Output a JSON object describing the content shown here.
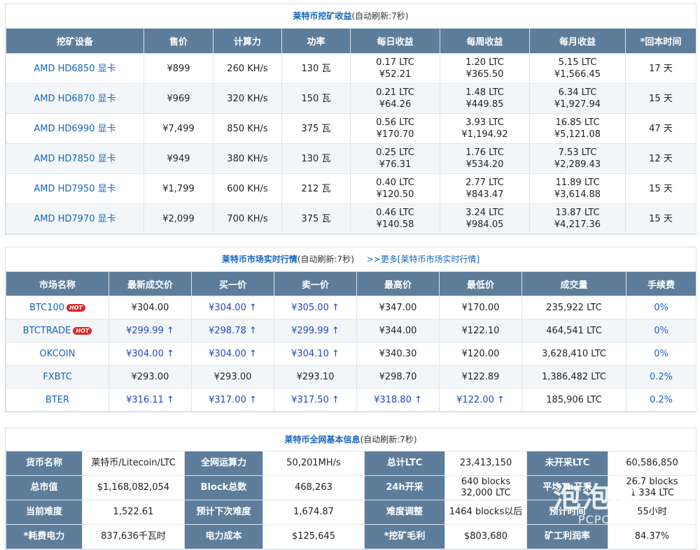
{
  "mining": {
    "title": "莱特币挖矿收益",
    "title_note": "(自动刷新:7秒)",
    "headers": [
      "挖矿设备",
      "售价",
      "计算力",
      "功率",
      "每日收益",
      "每周收益",
      "每月收益",
      "*回本时间"
    ],
    "rows": [
      {
        "device": "AMD HD6850 显卡",
        "price": "¥899",
        "hash": "260 KH/s",
        "power": "130 瓦",
        "day_ltc": "0.17 LTC",
        "day_cny": "¥52.21",
        "week_ltc": "1.20 LTC",
        "week_cny": "¥365.50",
        "month_ltc": "5.15 LTC",
        "month_cny": "¥1,566.45",
        "payback": "17 天"
      },
      {
        "device": "AMD HD6870 显卡",
        "price": "¥969",
        "hash": "320 KH/s",
        "power": "150 瓦",
        "day_ltc": "0.21 LTC",
        "day_cny": "¥64.26",
        "week_ltc": "1.48 LTC",
        "week_cny": "¥449.85",
        "month_ltc": "6.34 LTC",
        "month_cny": "¥1,927.94",
        "payback": "15 天"
      },
      {
        "device": "AMD HD6990 显卡",
        "price": "¥7,499",
        "hash": "850 KH/s",
        "power": "375 瓦",
        "day_ltc": "0.56 LTC",
        "day_cny": "¥170.70",
        "week_ltc": "3.93 LTC",
        "week_cny": "¥1,194.92",
        "month_ltc": "16.85 LTC",
        "month_cny": "¥5,121.08",
        "payback": "47 天"
      },
      {
        "device": "AMD HD7850 显卡",
        "price": "¥949",
        "hash": "380 KH/s",
        "power": "130 瓦",
        "day_ltc": "0.25 LTC",
        "day_cny": "¥76.31",
        "week_ltc": "1.76 LTC",
        "week_cny": "¥534.20",
        "month_ltc": "7.53 LTC",
        "month_cny": "¥2,289.43",
        "payback": "12 天"
      },
      {
        "device": "AMD HD7950 显卡",
        "price": "¥1,799",
        "hash": "600 KH/s",
        "power": "212 瓦",
        "day_ltc": "0.40 LTC",
        "day_cny": "¥120.50",
        "week_ltc": "2.77 LTC",
        "week_cny": "¥843.47",
        "month_ltc": "11.89 LTC",
        "month_cny": "¥3,614.88",
        "payback": "15 天"
      },
      {
        "device": "AMD HD7970 显卡",
        "price": "¥2,099",
        "hash": "700 KH/s",
        "power": "375 瓦",
        "day_ltc": "0.46 LTC",
        "day_cny": "¥140.58",
        "week_ltc": "3.24 LTC",
        "week_cny": "¥984.05",
        "month_ltc": "13.87 LTC",
        "month_cny": "¥4,217.36",
        "payback": "15 天"
      }
    ]
  },
  "market": {
    "title": "莱特币市场实时行情",
    "title_note": "(自动刷新:7秒)",
    "more_link": ">>更多[莱特币市场实时行情]",
    "hot_label": "HOT",
    "headers": [
      "市场名称",
      "最新成交价",
      "买一价",
      "卖一价",
      "最高价",
      "最低价",
      "成交量",
      "手续费"
    ],
    "rows": [
      {
        "name": "BTC100",
        "hot": true,
        "last": "¥304.00",
        "last_up": false,
        "buy": "¥304.00 ↑",
        "buy_up": true,
        "sell": "¥305.00 ↑",
        "sell_up": true,
        "high": "¥347.00",
        "high_up": false,
        "low": "¥170.00",
        "low_up": false,
        "volume": "235,922 LTC",
        "fee": "0%"
      },
      {
        "name": "BTCTRADE",
        "hot": true,
        "last": "¥299.99 ↑",
        "last_up": true,
        "buy": "¥298.78 ↑",
        "buy_up": true,
        "sell": "¥299.99 ↑",
        "sell_up": true,
        "high": "¥344.00",
        "high_up": false,
        "low": "¥122.10",
        "low_up": false,
        "volume": "464,541 LTC",
        "fee": "0%"
      },
      {
        "name": "OKCOIN",
        "hot": false,
        "last": "¥304.00 ↑",
        "last_up": true,
        "buy": "¥304.00 ↑",
        "buy_up": true,
        "sell": "¥304.10 ↑",
        "sell_up": true,
        "high": "¥340.30",
        "high_up": false,
        "low": "¥120.00",
        "low_up": false,
        "volume": "3,628,410 LTC",
        "fee": "0%"
      },
      {
        "name": "FXBTC",
        "hot": false,
        "last": "¥293.00",
        "last_up": false,
        "buy": "¥293.00",
        "buy_up": false,
        "sell": "¥293.10",
        "sell_up": false,
        "high": "¥298.70",
        "high_up": false,
        "low": "¥122.89",
        "low_up": false,
        "volume": "1,386,482 LTC",
        "fee": "0.2%"
      },
      {
        "name": "BTER",
        "hot": false,
        "last": "¥316.11 ↑",
        "last_up": true,
        "buy": "¥317.00 ↑",
        "buy_up": true,
        "sell": "¥317.50 ↑",
        "sell_up": true,
        "high": "¥318.80 ↑",
        "high_up": true,
        "low": "¥122.00 ↑",
        "low_up": true,
        "volume": "185,906 LTC",
        "fee": "0.2%"
      }
    ]
  },
  "network": {
    "title": "莱特币全网基本信息",
    "title_note": "(自动刷新:7秒)",
    "rows": [
      [
        {
          "label": "货币名称",
          "value": "莱特币/Litecoin/LTC"
        },
        {
          "label": "全网运算力",
          "value": "50,201MH/s"
        },
        {
          "label": "总计LTC",
          "value": "23,413,150"
        },
        {
          "label": "未开采LTC",
          "value": "60,586,850"
        }
      ],
      [
        {
          "label": "总市值",
          "value": "$1,168,082,054"
        },
        {
          "label": "Block总数",
          "value": "468,263"
        },
        {
          "label": "24h开采",
          "value": "640 blocks",
          "value2": "32,000 LTC"
        },
        {
          "label": "平均1h开采",
          "value": "26.7 blocks",
          "value2": "1,334 LTC"
        }
      ],
      [
        {
          "label": "当前难度",
          "value": "1,522.61"
        },
        {
          "label": "预计下次难度",
          "value": "1,674.87"
        },
        {
          "label": "难度调整",
          "value": "1464 blocks以后"
        },
        {
          "label": "预计时间",
          "value": "55小时"
        }
      ],
      [
        {
          "label": "*耗费电力",
          "value": "837,636千瓦时"
        },
        {
          "label": "电力成本",
          "value": "$125,645"
        },
        {
          "label": "*挖矿毛利",
          "value": "$803,680"
        },
        {
          "label": "矿工利润率",
          "value": "84.37%"
        }
      ]
    ]
  },
  "watermark": {
    "main": "泡泡网",
    "sub": "PCPOP.COM"
  },
  "colors": {
    "header_bg": "#5e7d9a",
    "accent_blue": "#1565c0",
    "up_blue": "#2147c8",
    "hot_red": "#d9262a"
  }
}
